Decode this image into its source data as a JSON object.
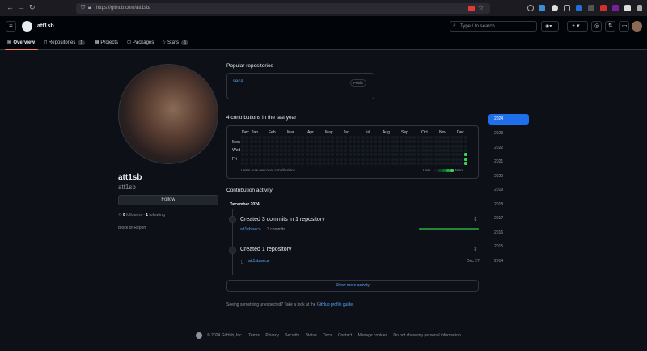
{
  "browser": {
    "url": "https://github.com/att1sb/"
  },
  "header": {
    "title": "att1sb",
    "search_placeholder": "Type / to search"
  },
  "tabs": [
    {
      "label": "Overview"
    },
    {
      "label": "Repositories",
      "count": "1"
    },
    {
      "label": "Projects"
    },
    {
      "label": "Packages"
    },
    {
      "label": "Stars",
      "count": "5"
    }
  ],
  "profile": {
    "name": "att1sb",
    "login": "att1sb",
    "follow_label": "Follow",
    "followers_count": "0",
    "followers_label": "followers",
    "following_count": "1",
    "following_label": "following",
    "block_label": "Block or Report"
  },
  "popular": {
    "title": "Popular repositories",
    "repo_name": "seca",
    "repo_badge": "Public"
  },
  "contributions": {
    "title": "4 contributions in the last year",
    "months": [
      "Dec",
      "Jan",
      "Feb",
      "Mar",
      "Apr",
      "May",
      "Jun",
      "Jul",
      "Aug",
      "Sep",
      "Oct",
      "Nov",
      "Dec"
    ],
    "days": [
      "Mon",
      "Wed",
      "Fri"
    ],
    "learn": "Learn how we count contributions",
    "less": "Less",
    "more": "More"
  },
  "years": [
    "2024",
    "2023",
    "2022",
    "2021",
    "2020",
    "2019",
    "2018",
    "2017",
    "2016",
    "2015",
    "2014"
  ],
  "activity": {
    "title": "Contribution activity",
    "month": "December 2024",
    "commits_title": "Created 3 commits in 1 repository",
    "commits_repo": "att1sb/seca",
    "commits_count": "3 commits",
    "created_title": "Created 1 repository",
    "created_repo": "att1sb/seca",
    "created_date": "Dec 27",
    "show_more": "Show more activity",
    "seeing_text": "Seeing something unexpected? Take a look at the",
    "seeing_link": "GitHub profile guide",
    "seeing_end": "."
  },
  "footer": {
    "copyright": "© 2024 GitHub, Inc.",
    "links": [
      "Terms",
      "Privacy",
      "Security",
      "Status",
      "Docs",
      "Contact",
      "Manage cookies",
      "Do not share my personal information"
    ]
  },
  "colors": {
    "accent": "#1f6feb",
    "link": "#58a6ff",
    "green": "#238636",
    "green_bright": "#39d353"
  }
}
